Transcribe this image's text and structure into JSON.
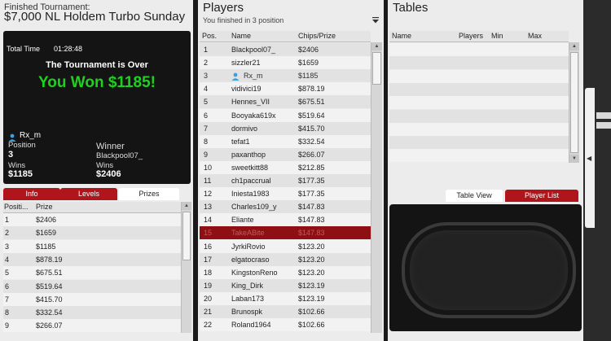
{
  "tournament": {
    "label": "Finished Tournament:",
    "name": "$7,000 NL Holdem Turbo Sunday",
    "total_time_label": "Total Time",
    "total_time": "01:28:48",
    "status": "The Tournament is Over",
    "result": "You Won $1185!",
    "player": {
      "name": "Rx_m",
      "position_label": "Position",
      "position": "3",
      "wins_label": "Wins",
      "wins": "$1185"
    },
    "winner": {
      "label": "Winner",
      "name": "Blackpool07_",
      "wins_label": "Wins",
      "wins": "$2406"
    }
  },
  "left_tabs": [
    {
      "label": "Info",
      "active": false
    },
    {
      "label": "Levels",
      "active": false
    },
    {
      "label": "Prizes",
      "active": true
    }
  ],
  "prizes": {
    "headers": {
      "position": "Positi...",
      "prize": "Prize"
    },
    "rows": [
      {
        "pos": "1",
        "prize": "$2406"
      },
      {
        "pos": "2",
        "prize": "$1659"
      },
      {
        "pos": "3",
        "prize": "$1185"
      },
      {
        "pos": "4",
        "prize": "$878.19"
      },
      {
        "pos": "5",
        "prize": "$675.51"
      },
      {
        "pos": "6",
        "prize": "$519.64"
      },
      {
        "pos": "7",
        "prize": "$415.70"
      },
      {
        "pos": "8",
        "prize": "$332.54"
      },
      {
        "pos": "9",
        "prize": "$266.07"
      }
    ]
  },
  "players": {
    "title": "Players",
    "subtitle": "You finished in 3 position",
    "headers": {
      "pos": "Pos.",
      "name": "Name",
      "chips": "Chips/Prize"
    },
    "rows": [
      {
        "pos": "1",
        "name": "Blackpool07_",
        "chips": "$2406"
      },
      {
        "pos": "2",
        "name": "sizzler21",
        "chips": "$1659"
      },
      {
        "pos": "3",
        "name": "Rx_m",
        "chips": "$1185",
        "me": true
      },
      {
        "pos": "4",
        "name": "vidivici19",
        "chips": "$878.19"
      },
      {
        "pos": "5",
        "name": "Hennes_VII",
        "chips": "$675.51"
      },
      {
        "pos": "6",
        "name": "Booyaka619x",
        "chips": "$519.64"
      },
      {
        "pos": "7",
        "name": "dormivo",
        "chips": "$415.70"
      },
      {
        "pos": "8",
        "name": "tefat1",
        "chips": "$332.54"
      },
      {
        "pos": "9",
        "name": "paxanthop",
        "chips": "$266.07"
      },
      {
        "pos": "10",
        "name": "sweetkitt88",
        "chips": "$212.85"
      },
      {
        "pos": "11",
        "name": "ch1paccrual",
        "chips": "$177.35"
      },
      {
        "pos": "12",
        "name": "Iniesta1983",
        "chips": "$177.35"
      },
      {
        "pos": "13",
        "name": "Charles109_y",
        "chips": "$147.83"
      },
      {
        "pos": "14",
        "name": "Eliante",
        "chips": "$147.83"
      },
      {
        "pos": "15",
        "name": "TakeABite",
        "chips": "$147.83",
        "highlight": true
      },
      {
        "pos": "16",
        "name": "JyrkiRovio",
        "chips": "$123.20"
      },
      {
        "pos": "17",
        "name": "elgatocraso",
        "chips": "$123.20"
      },
      {
        "pos": "18",
        "name": "KingstonReno",
        "chips": "$123.20"
      },
      {
        "pos": "19",
        "name": "King_Dirk",
        "chips": "$123.19"
      },
      {
        "pos": "20",
        "name": "Laban173",
        "chips": "$123.19"
      },
      {
        "pos": "21",
        "name": "Brunospk",
        "chips": "$102.66"
      },
      {
        "pos": "22",
        "name": "Roland1964",
        "chips": "$102.66"
      }
    ]
  },
  "tables": {
    "title": "Tables",
    "headers": {
      "name": "Name",
      "players": "Players",
      "min": "Min",
      "max": "Max"
    },
    "tabs": [
      {
        "label": "Table View",
        "active": true
      },
      {
        "label": "Player List",
        "active": false
      }
    ]
  },
  "colors": {
    "accent_red": "#b0151b",
    "win_green": "#20d020",
    "highlight_row": "#8e1014"
  },
  "icons": {
    "player": "person-icon",
    "filter": "filter-icon",
    "scroll_up": "arrow-up-icon",
    "scroll_down": "arrow-down-icon",
    "collapse": "chevron-left-icon"
  }
}
